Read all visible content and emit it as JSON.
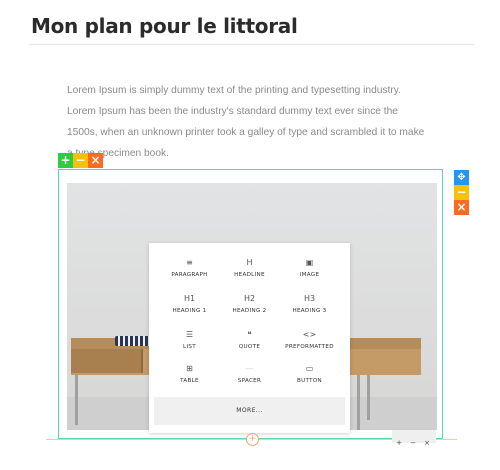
{
  "page": {
    "title": "Mon plan pour le littoral",
    "paragraph_lines": [
      "Lorem Ipsum is simply dummy text of the printing and typesetting industry.",
      "Lorem Ipsum has been the industry's standard dummy text ever since the",
      "1500s, when an unknown printer took a galley of type and scrambled it to make",
      "a type specimen book."
    ]
  },
  "colors": {
    "add": "#2ecc40",
    "minimize": "#f4c20d",
    "remove": "#ff6a21",
    "move": "#2196f3",
    "frame": "#5ad6b4",
    "divider": "#f5c9a8"
  },
  "block_controls_left": {
    "add": "+",
    "minimize": "−",
    "remove": "×"
  },
  "block_controls_right": {
    "move": "✥",
    "minimize": "−",
    "remove": "×"
  },
  "inserter": {
    "items": [
      {
        "icon": "≡",
        "label": "PARAGRAPH",
        "icon_name": "paragraph-icon"
      },
      {
        "icon": "H",
        "label": "HEADLINE",
        "icon_name": "headline-icon"
      },
      {
        "icon": "▣",
        "label": "IMAGE",
        "icon_name": "image-icon"
      },
      {
        "icon": "H1",
        "label": "HEADING 1",
        "icon_name": "heading1-icon"
      },
      {
        "icon": "H2",
        "label": "HEADING 2",
        "icon_name": "heading2-icon"
      },
      {
        "icon": "H3",
        "label": "HEADING 3",
        "icon_name": "heading3-icon"
      },
      {
        "icon": "☰",
        "label": "LIST",
        "icon_name": "list-icon"
      },
      {
        "icon": "❝",
        "label": "QUOTE",
        "icon_name": "quote-icon"
      },
      {
        "icon": "<>",
        "label": "PREFORMATTED",
        "icon_name": "code-icon"
      },
      {
        "icon": "⊞",
        "label": "TABLE",
        "icon_name": "table-icon"
      },
      {
        "icon": "—",
        "label": "SPACER",
        "icon_name": "spacer-icon"
      },
      {
        "icon": "▭",
        "label": "BUTTON",
        "icon_name": "button-icon"
      }
    ],
    "more_label": "MORE..."
  },
  "bottom_add": "+",
  "mini_controls": [
    "+",
    "−",
    "×"
  ]
}
